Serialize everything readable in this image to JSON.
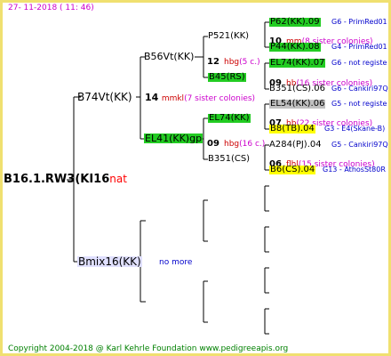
{
  "timestamp": "27- 11-2018 ( 11: 46)",
  "copyright": "Copyright 2004-2018 @ Karl Kehrle Foundation    www.pedigreeapis.org",
  "root": {
    "name": "B16.1.RW3(KI16",
    "suffix": "nat"
  },
  "sire": {
    "name": "B74Vt(KK)",
    "count": "14",
    "mark": "mmkl",
    "sisters": "(7 sister colonies)"
  },
  "dam": {
    "name": "Bmix16(KK)",
    "note": "no more"
  },
  "sire_sire": {
    "name": "B56Vt(KK)",
    "count": "12",
    "mark": "hbg",
    "sisters": "(5 c.)"
  },
  "sire_dam": {
    "name": "EL41(KK)gp",
    "count": "09",
    "mark": "hbg",
    "sisters": "(16 c.)"
  },
  "ss_sire": {
    "name": "P521(KK)",
    "count": "10",
    "mark": "mm",
    "sisters": "(8 sister colonies)"
  },
  "ss_dam": {
    "name": "B45(RS)",
    "count": "09",
    "mark": "hb",
    "sisters": "(16 sister colonies)"
  },
  "sd_sire": {
    "name": "EL74(KK)",
    "count": "07",
    "mark": "hb",
    "sisters": "(22 sister colonies)"
  },
  "sd_dam": {
    "name": "B351(CS)",
    "count": "06",
    "mark": "flhl",
    "sisters": "(15 sister colonies)"
  },
  "gen4": [
    {
      "name": "P62(KK).09",
      "code": "G6 - PrimRed01"
    },
    {
      "name": "P44(KK).08",
      "code": "G4 - PrimRed01"
    },
    {
      "name": "EL74(KK).07",
      "code": "G6 - not registe"
    },
    {
      "name": "B351(CS).06",
      "code": "G6 - Cankiri97Q"
    },
    {
      "name": "EL54(KK).06",
      "code": "G5 - not registe"
    },
    {
      "name": "B8(TB).04",
      "code": "G3 - E4(Skane-B)"
    },
    {
      "name": "A284(PJ).04",
      "code": "G5 - Cankiri97Q"
    },
    {
      "name": "B6(CS).04",
      "code": "G13 - AthosSt80R"
    }
  ]
}
